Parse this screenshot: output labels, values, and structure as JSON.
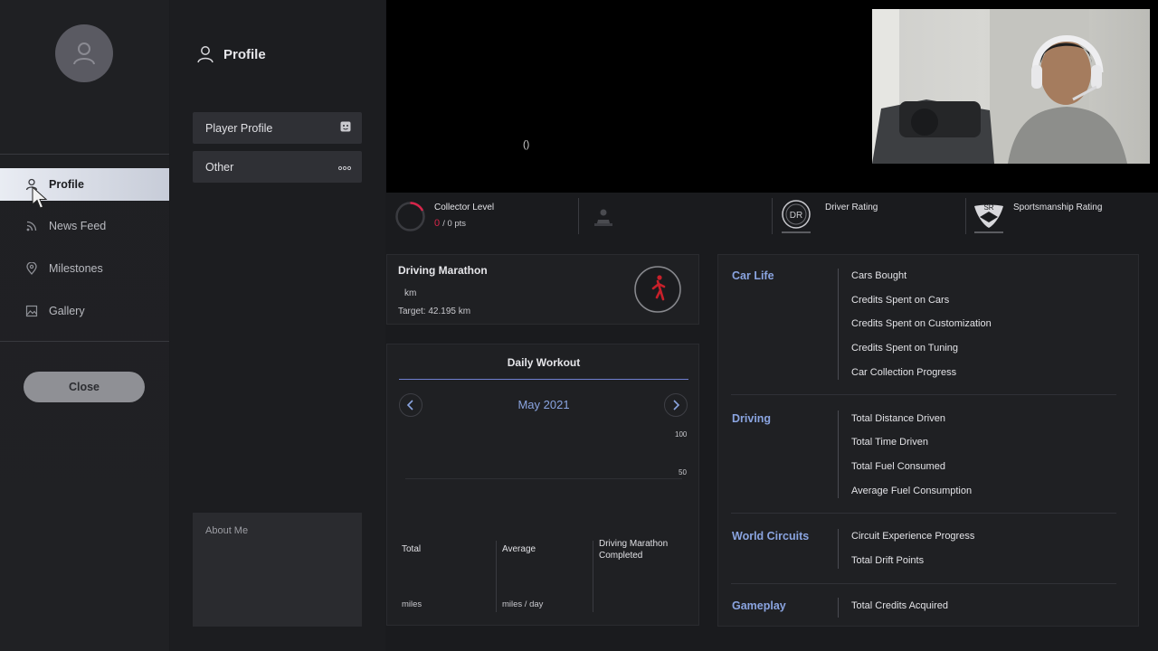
{
  "sidebar": {
    "items": [
      {
        "label": "Profile",
        "icon": "person-icon",
        "active": true
      },
      {
        "label": "News Feed",
        "icon": "rss-icon",
        "active": false
      },
      {
        "label": "Milestones",
        "icon": "location-pin-icon",
        "active": false
      },
      {
        "label": "Gallery",
        "icon": "gallery-icon",
        "active": false
      }
    ],
    "close_label": "Close"
  },
  "middle": {
    "title": "Profile",
    "menu": [
      {
        "label": "Player Profile",
        "icon": "face-icon"
      },
      {
        "label": "Other",
        "icon": "more-dots-icon"
      }
    ],
    "about_label": "About Me"
  },
  "video": {
    "overlay_text": "()"
  },
  "stats_bar": {
    "collector_level_label": "Collector Level",
    "collector_points_value": "0",
    "collector_points_rest": "/ 0 pts",
    "driver_rating_label": "Driver Rating",
    "driver_rating_badge": "DR",
    "sportsmanship_label": "Sportsmanship Rating",
    "sportsmanship_badge": "SR"
  },
  "marathon": {
    "title": "Driving Marathon",
    "unit": "km",
    "target": "Target: 42.195 km"
  },
  "workout": {
    "title": "Daily Workout",
    "month": "May 2021",
    "tick_100": "100",
    "tick_50": "50",
    "summary": [
      {
        "label": "Total",
        "unit": "miles"
      },
      {
        "label": "Average",
        "unit": "miles / day"
      },
      {
        "label": "Driving Marathon Completed",
        "unit": ""
      }
    ]
  },
  "stats": {
    "car_life": {
      "title": "Car Life",
      "rows": [
        "Cars Bought",
        "Credits Spent on Cars",
        "Credits Spent on Customization",
        "Credits Spent on Tuning",
        "Car Collection Progress"
      ]
    },
    "driving": {
      "title": "Driving",
      "rows": [
        "Total Distance Driven",
        "Total Time Driven",
        "Total Fuel Consumed",
        "Average Fuel Consumption"
      ]
    },
    "world_circuits": {
      "title": "World Circuits",
      "rows": [
        "Circuit Experience Progress",
        "Total Drift Points"
      ]
    },
    "gameplay": {
      "title": "Gameplay",
      "rows": [
        "Total Credits Acquired"
      ]
    }
  },
  "colors": {
    "accent_blue": "#8aa4e0",
    "collector_red": "#d8254a",
    "marathon_red": "#c8202a"
  }
}
